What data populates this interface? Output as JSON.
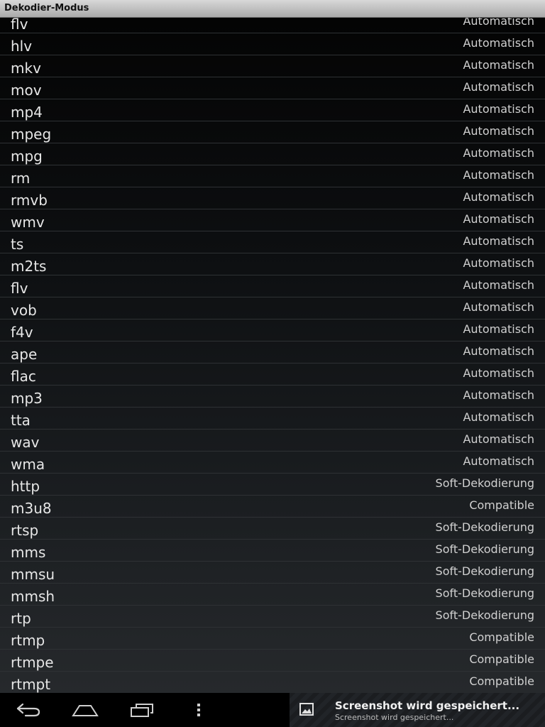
{
  "window": {
    "title": "Dekodier-Modus"
  },
  "list": {
    "rows": [
      {
        "ext": "flv",
        "mode": "Automatisch"
      },
      {
        "ext": "hlv",
        "mode": "Automatisch"
      },
      {
        "ext": "mkv",
        "mode": "Automatisch"
      },
      {
        "ext": "mov",
        "mode": "Automatisch"
      },
      {
        "ext": "mp4",
        "mode": "Automatisch"
      },
      {
        "ext": "mpeg",
        "mode": "Automatisch"
      },
      {
        "ext": "mpg",
        "mode": "Automatisch"
      },
      {
        "ext": "rm",
        "mode": "Automatisch"
      },
      {
        "ext": "rmvb",
        "mode": "Automatisch"
      },
      {
        "ext": "wmv",
        "mode": "Automatisch"
      },
      {
        "ext": "ts",
        "mode": "Automatisch"
      },
      {
        "ext": "m2ts",
        "mode": "Automatisch"
      },
      {
        "ext": "flv",
        "mode": "Automatisch"
      },
      {
        "ext": "vob",
        "mode": "Automatisch"
      },
      {
        "ext": "f4v",
        "mode": "Automatisch"
      },
      {
        "ext": "ape",
        "mode": "Automatisch"
      },
      {
        "ext": "flac",
        "mode": "Automatisch"
      },
      {
        "ext": "mp3",
        "mode": "Automatisch"
      },
      {
        "ext": "tta",
        "mode": "Automatisch"
      },
      {
        "ext": "wav",
        "mode": "Automatisch"
      },
      {
        "ext": "wma",
        "mode": "Automatisch"
      },
      {
        "ext": "http",
        "mode": "Soft-Dekodierung"
      },
      {
        "ext": "m3u8",
        "mode": "Compatible"
      },
      {
        "ext": "rtsp",
        "mode": "Soft-Dekodierung"
      },
      {
        "ext": "mms",
        "mode": "Soft-Dekodierung"
      },
      {
        "ext": "mmsu",
        "mode": "Soft-Dekodierung"
      },
      {
        "ext": "mmsh",
        "mode": "Soft-Dekodierung"
      },
      {
        "ext": "rtp",
        "mode": "Soft-Dekodierung"
      },
      {
        "ext": "rtmp",
        "mode": "Compatible"
      },
      {
        "ext": "rtmpe",
        "mode": "Compatible"
      },
      {
        "ext": "rtmpt",
        "mode": "Compatible"
      }
    ]
  },
  "navbar": {
    "back": "back-icon",
    "home": "home-icon",
    "recents": "recent-apps-icon",
    "menu": "menu-icon"
  },
  "notification": {
    "icon": "image-icon",
    "title": "Screenshot wird gespeichert...",
    "text": "Screenshot wird gespeichert..."
  },
  "colors": {
    "title_bar": "#c4c4c4",
    "text": "#e6e6e6",
    "divider": "#2e3134"
  }
}
